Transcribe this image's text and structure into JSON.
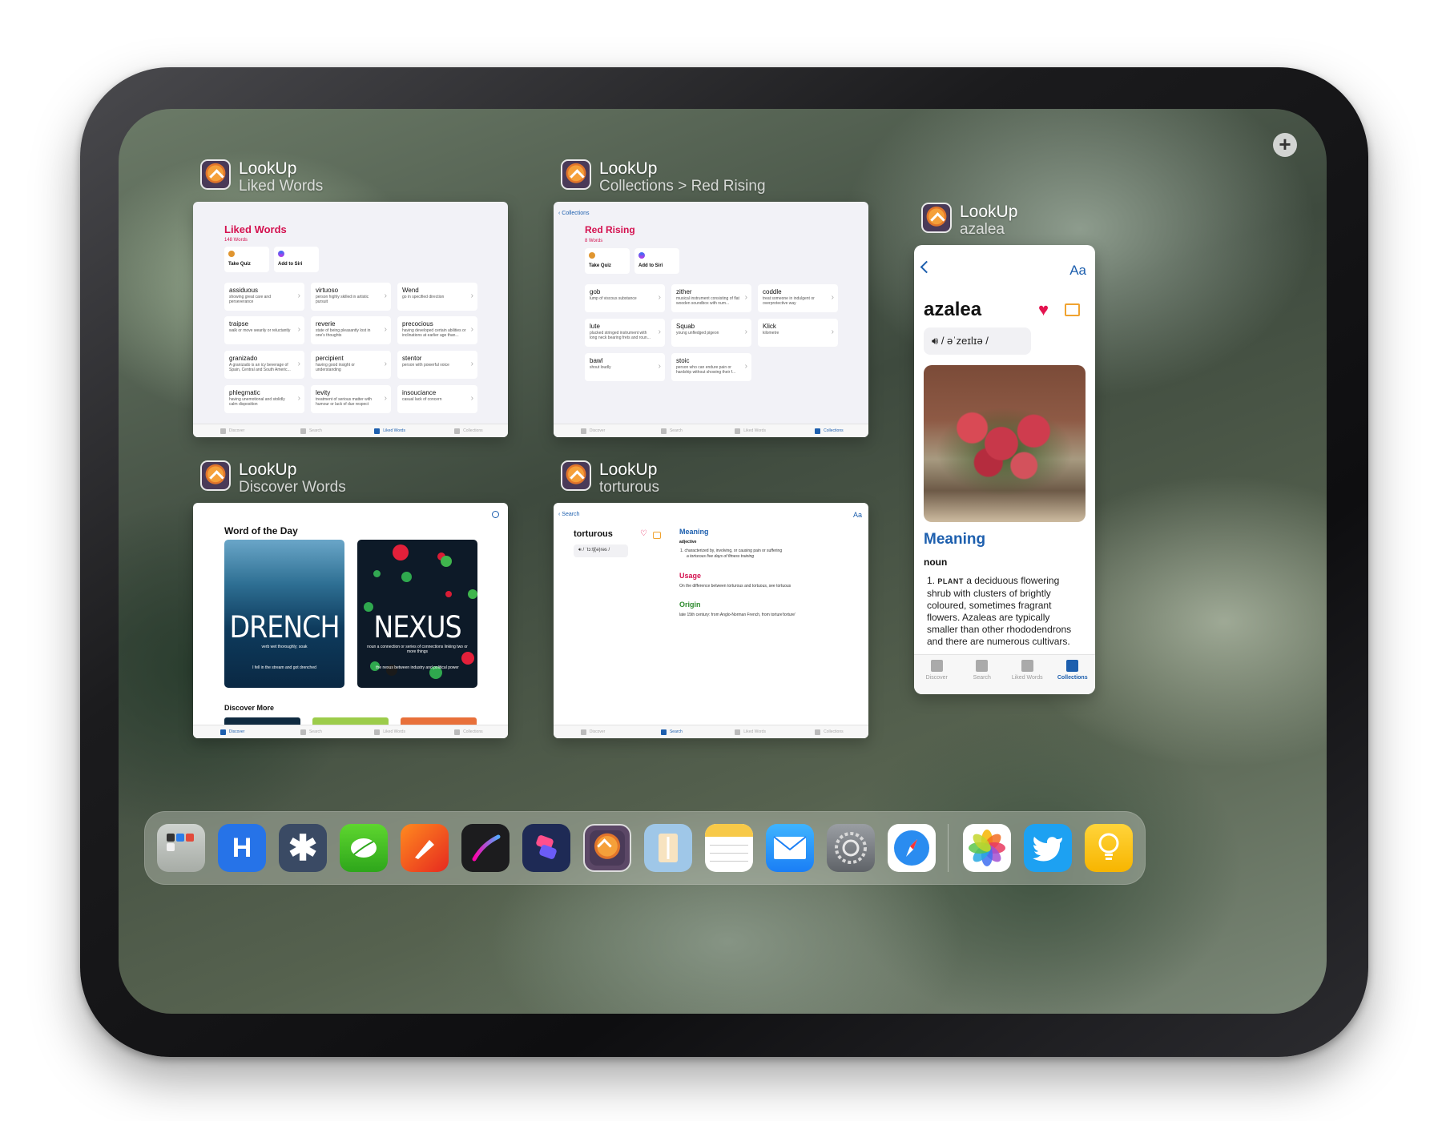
{
  "switcher": {
    "add_symbol": "+",
    "cards": [
      {
        "app": "LookUp",
        "subtitle": "Liked Words"
      },
      {
        "app": "LookUp",
        "subtitle": "Collections > Red Rising"
      },
      {
        "app": "LookUp",
        "subtitle": "azalea"
      },
      {
        "app": "LookUp",
        "subtitle": "Discover Words"
      },
      {
        "app": "LookUp",
        "subtitle": "torturous"
      }
    ]
  },
  "tabs": {
    "discover": "Discover",
    "search": "Search",
    "liked": "Liked Words",
    "collections": "Collections"
  },
  "liked_words": {
    "title": "Liked Words",
    "count": "148 Words",
    "quiz_label": "Take Quiz",
    "siri_label": "Add to Siri",
    "words": [
      {
        "word": "assiduous",
        "def": "showing great care and perseverance"
      },
      {
        "word": "virtuoso",
        "def": "person highly skilled in artistic pursuit"
      },
      {
        "word": "Wend",
        "def": "go in specified direction"
      },
      {
        "word": "traipse",
        "def": "walk or move wearily or reluctantly"
      },
      {
        "word": "reverie",
        "def": "state of being pleasantly lost in one's thoughts"
      },
      {
        "word": "precocious",
        "def": "having developed certain abilities or inclinations at earlier age than..."
      },
      {
        "word": "granizado",
        "def": "A granizado is an icy beverage of Spain, Central and South Americ..."
      },
      {
        "word": "percipient",
        "def": "having good insight or understanding"
      },
      {
        "word": "stentor",
        "def": "person with powerful voice"
      },
      {
        "word": "phlegmatic",
        "def": "having unemotional and stolidly calm disposition"
      },
      {
        "word": "levity",
        "def": "treatment of serious matter with humour or lack of due respect"
      },
      {
        "word": "insouciance",
        "def": "casual lack of concern"
      }
    ]
  },
  "red_rising": {
    "back": "Collections",
    "title": "Red Rising",
    "count": "8 Words",
    "quiz_label": "Take Quiz",
    "siri_label": "Add to Siri",
    "words": [
      {
        "word": "gob",
        "def": "lump of viscous substance"
      },
      {
        "word": "zither",
        "def": "musical instrument consisting of flat wooden soundbox with num..."
      },
      {
        "word": "coddle",
        "def": "treat someone in indulgent or overprotective way"
      },
      {
        "word": "lute",
        "def": "plucked stringed instrument with long neck bearing frets and roun..."
      },
      {
        "word": "Squab",
        "def": "young unfledged pigeon"
      },
      {
        "word": "Klick",
        "def": "kilometre"
      },
      {
        "word": "bawl",
        "def": "shout loudly"
      },
      {
        "word": "stoic",
        "def": "person who can endure pain or hardship without showing their f..."
      }
    ]
  },
  "discover": {
    "wod_title": "Word of the Day",
    "drench_word": "DRENCH",
    "drench_pos": "verb wet thoroughly; soak",
    "drench_example": "I fell in the stream and got drenched",
    "nexus_word": "NEXUS",
    "nexus_pos": "noun a connection or series of connections linking two or more things",
    "nexus_example": "the nexus between industry and political power",
    "more_title": "Discover More"
  },
  "torturous": {
    "back": "Search",
    "aa": "Aa",
    "word": "torturous",
    "pron": "/ ˈtɔːtʃ(ə)rəs /",
    "meaning_h": "Meaning",
    "pos": "adjective",
    "def": "1. characterized by, involving, or causing pain or suffering",
    "example": "a torturous five days of fitness training",
    "usage_h": "Usage",
    "usage": "On the difference between torturous and tortuous, see tortuous",
    "origin_h": "Origin",
    "origin": "late 15th century: from Anglo-Norman French, from torture'torture'"
  },
  "azalea": {
    "aa": "Aa",
    "word": "azalea",
    "pron": "/ əˈzeɪlɪə /",
    "meaning_h": "Meaning",
    "pos": "noun",
    "num": "1.",
    "tag": "PLANT",
    "def": "a deciduous flowering shrub with clusters of brightly coloured, sometimes fragrant flowers. Azaleas are typically smaller than other rhododendrons and there are numerous cultivars."
  },
  "dock": {
    "icons": [
      "folder-icon",
      "hey-h-icon",
      "star-asterisk-icon",
      "leaf-chat-icon",
      "pen-nib-icon",
      "procreate-icon",
      "shortcuts-icon",
      "lookup-icon",
      "pencil-icon",
      "notes-icon",
      "mail-icon",
      "settings-gear-icon",
      "safari-compass-icon",
      "photos-icon",
      "twitter-bird-icon",
      "tips-bulb-icon"
    ],
    "hey_letter": "H"
  },
  "colors": {
    "accent_red": "#d4114f",
    "accent_blue": "#1d5fae",
    "origin_green": "#2e8b2e"
  }
}
